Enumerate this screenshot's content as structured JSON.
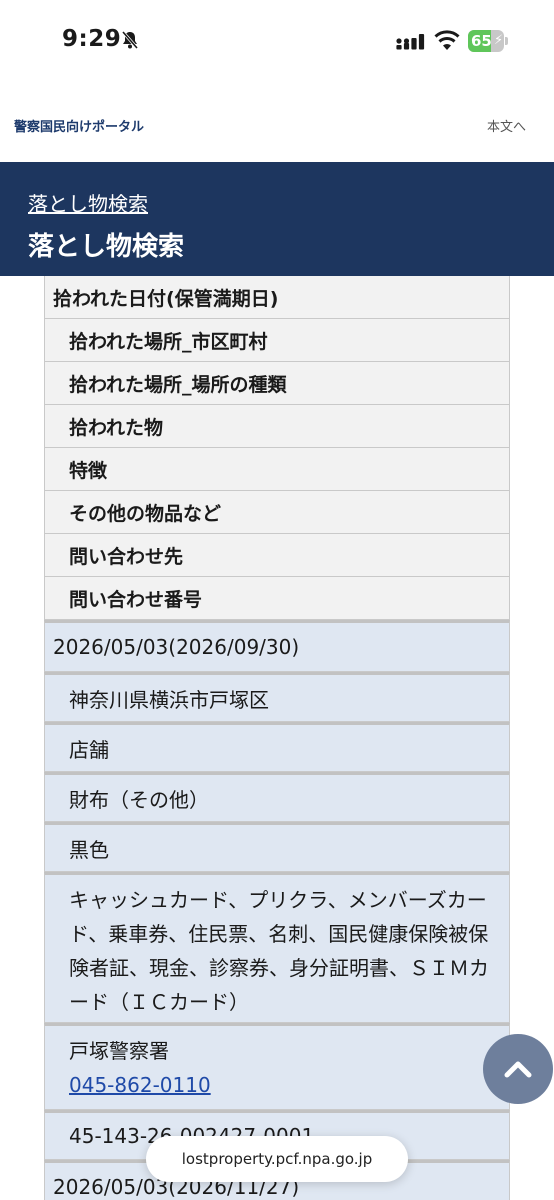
{
  "status_bar": {
    "time": "9:29",
    "battery_level": 65,
    "battery_text": "65",
    "icons": [
      "bell-slash-icon",
      "signal-icon",
      "wifi-icon",
      "battery-icon"
    ],
    "battery_color": "#5fc65a"
  },
  "site_header": {
    "portal_link": "警察国民向けポータル",
    "skip_link": "本文へ"
  },
  "banner": {
    "breadcrumb": "落とし物検索",
    "title": "落とし物検索",
    "color": "#1d365f"
  },
  "table": {
    "headers": [
      "拾われた日付(保管満期日)",
      "拾われた場所_市区町村",
      "拾われた場所_場所の種類",
      "拾われた物",
      "特徴",
      "その他の物品など",
      "問い合わせ先",
      "問い合わせ番号"
    ],
    "record": {
      "date": "2026/05/03(2026/09/30)",
      "city": "神奈川県横浜市戸塚区",
      "place_type": "店舗",
      "item": "財布（その他）",
      "feature": "黒色",
      "other_items": "キャッシュカード、プリクラ、メンバーズカード、乗車券、住民票、名刺、国民健康保険被保険者証、現金、診察券、身分証明書、ＳＩＭカード（ＩＣカード）",
      "contact_name": "戸塚警察署",
      "contact_phone": "045-862-0110",
      "inquiry_number": "45-143-26-002427-0001"
    },
    "next_record_date": "2026/05/03(2026/11/27)"
  },
  "url_bar": {
    "domain": "lostproperty.pcf.npa.go.jp"
  }
}
